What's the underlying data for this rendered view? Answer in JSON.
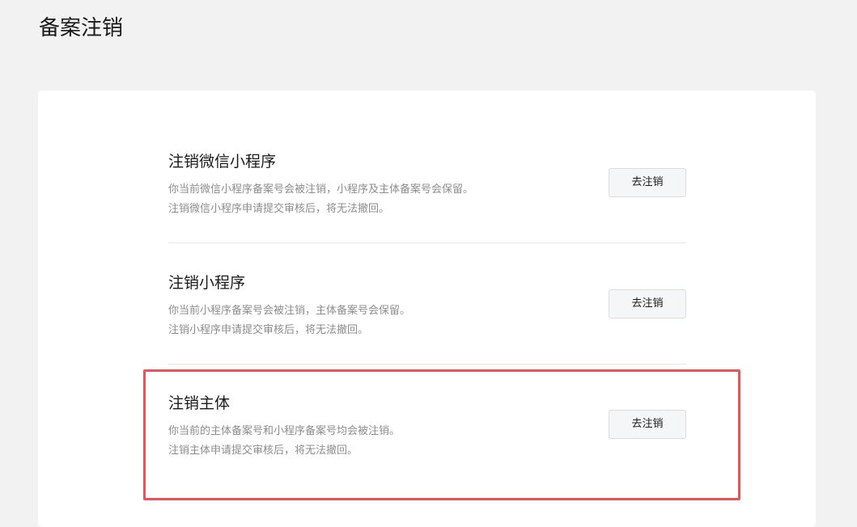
{
  "page": {
    "title": "备案注销"
  },
  "options": [
    {
      "title": "注销微信小程序",
      "desc_line1": "你当前微信小程序备案号会被注销，小程序及主体备案号会保留。",
      "desc_line2": "注销微信小程序申请提交审核后，将无法撤回。",
      "button_label": "去注销"
    },
    {
      "title": "注销小程序",
      "desc_line1": "你当前小程序备案号会被注销，主体备案号会保留。",
      "desc_line2": "注销小程序申请提交审核后，将无法撤回。",
      "button_label": "去注销"
    },
    {
      "title": "注销主体",
      "desc_line1": "你当前的主体备案号和小程序备案号均会被注销。",
      "desc_line2": "注销主体申请提交审核后，将无法撤回。",
      "button_label": "去注销"
    }
  ],
  "colors": {
    "page_background": "#f2f2f2",
    "card_background": "#ffffff",
    "highlight_border": "#e8545a",
    "secondary_text": "#8c8c8c"
  }
}
